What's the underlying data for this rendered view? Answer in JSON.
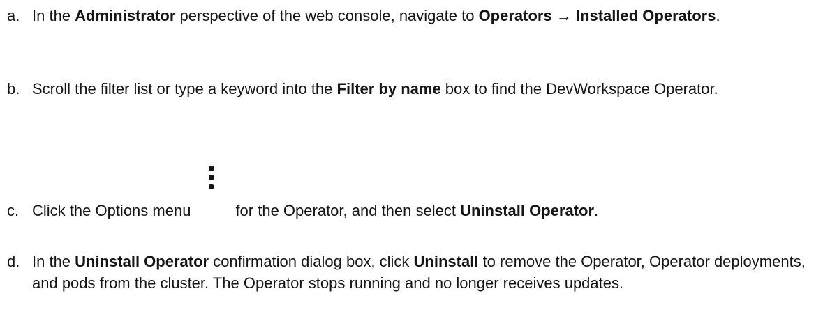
{
  "steps": [
    {
      "marker": "a.",
      "t1": "In the ",
      "b1": "Administrator",
      "t2": " perspective of the web console, navigate to  ",
      "b2": "Operators → Installed Operators",
      "t3": "."
    },
    {
      "marker": "b.",
      "t1": "Scroll the filter list or type a keyword into the ",
      "b1": "Filter by name",
      "t2": " box to find the DevWorkspace Operator."
    },
    {
      "marker": "c.",
      "t1": "Click the Options menu",
      "icon": "kebab-menu-icon",
      "t2": "for the Operator, and then select ",
      "b1": "Uninstall Operator",
      "t3": "."
    },
    {
      "marker": "d.",
      "t1": "In the ",
      "b1": "Uninstall Operator",
      "t2": " confirmation dialog box, click  ",
      "b2": "Uninstall",
      "t3": " to remove the Operator, Operator deployments, and pods from the cluster. The Operator stops running and no longer receives updates."
    }
  ]
}
